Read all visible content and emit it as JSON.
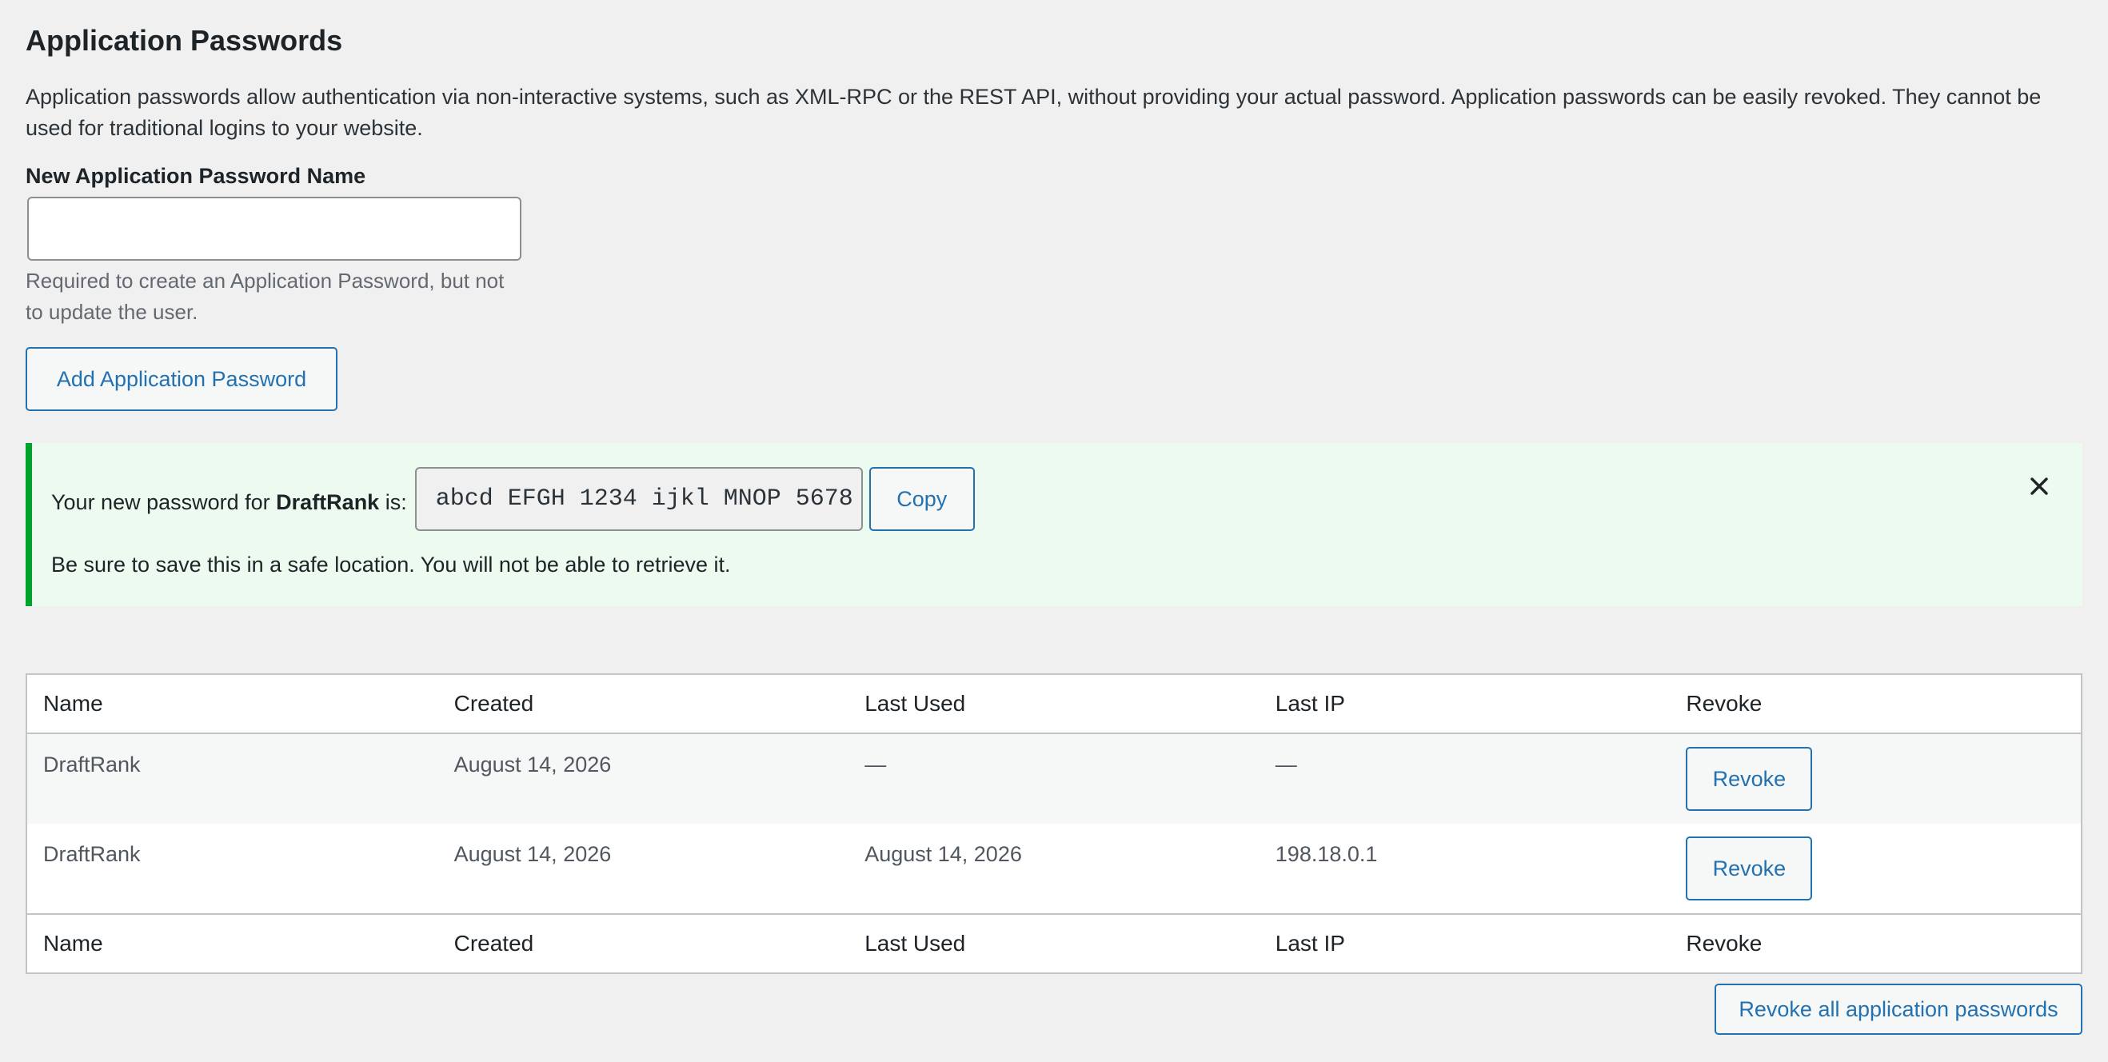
{
  "section": {
    "title": "Application Passwords",
    "description": "Application passwords allow authentication via non-interactive systems, such as XML-RPC or the REST API, without providing your actual password. Application passwords can be easily revoked. They cannot be used for traditional logins to your website."
  },
  "new_password_form": {
    "label": "New Application Password Name",
    "input_value": "",
    "help_text": "Required to create an Application Password, but not to update the user.",
    "add_button_label": "Add Application Password"
  },
  "notice": {
    "prefix": "Your new password for",
    "app_name": "DraftRank",
    "suffix": "is:",
    "password": "abcd EFGH 1234 ijkl MNOP 5678",
    "copy_label": "Copy",
    "warning": "Be sure to save this in a safe location. You will not be able to retrieve it.",
    "accent_color": "#00a32a",
    "background_color": "#edfaef"
  },
  "table": {
    "headers": [
      "Name",
      "Created",
      "Last Used",
      "Last IP",
      "Revoke"
    ],
    "rows": [
      {
        "name": "DraftRank",
        "created": "August 14, 2026",
        "last_used": "—",
        "last_ip": "—",
        "revoke_label": "Revoke"
      },
      {
        "name": "DraftRank",
        "created": "August 14, 2026",
        "last_used": "August 14, 2026",
        "last_ip": "198.18.0.1",
        "revoke_label": "Revoke"
      }
    ],
    "footers": [
      "Name",
      "Created",
      "Last Used",
      "Last IP",
      "Revoke"
    ]
  },
  "revoke_all_label": "Revoke all application passwords",
  "colors": {
    "accent": "#2271b1",
    "page_background": "#f0f0f1"
  }
}
